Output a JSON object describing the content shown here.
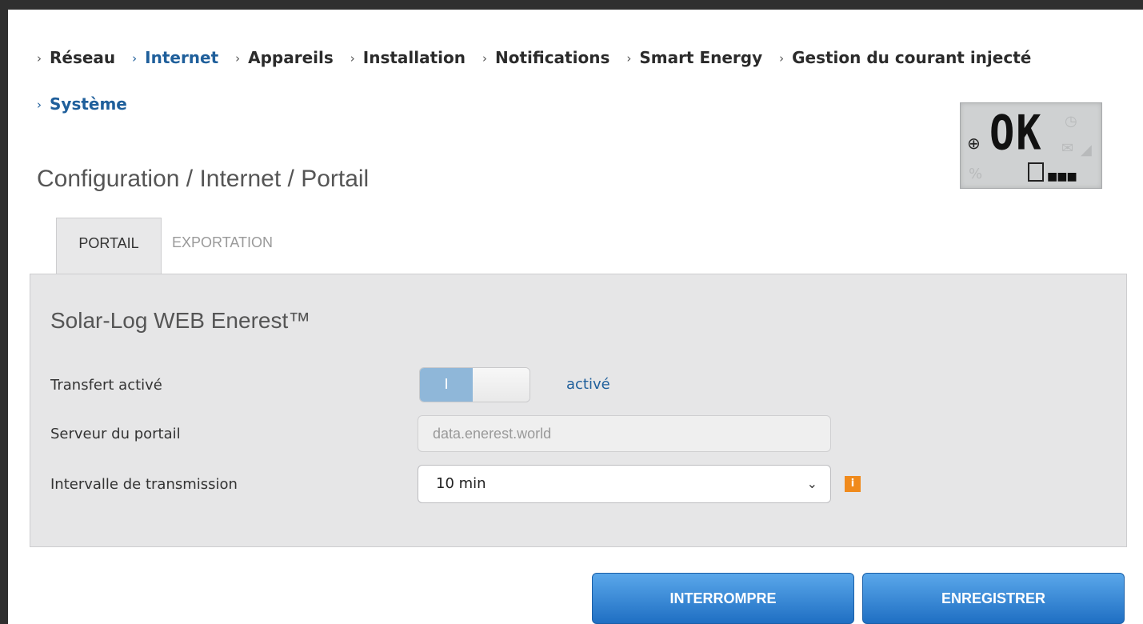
{
  "nav": {
    "items": [
      {
        "label": "Réseau"
      },
      {
        "label": "Internet"
      },
      {
        "label": "Appareils"
      },
      {
        "label": "Installation"
      },
      {
        "label": "Notifications"
      },
      {
        "label": "Smart Energy"
      },
      {
        "label": "Gestion du courant injecté"
      },
      {
        "label": "Système"
      }
    ],
    "chevron": "›"
  },
  "page": {
    "title": "Configuration / Internet / Portail"
  },
  "status_display": {
    "text": "OK",
    "icon": "globe-icon"
  },
  "tabs": [
    {
      "label": "PORTAIL"
    },
    {
      "label": "EXPORTATION"
    }
  ],
  "panel": {
    "title": "Solar-Log WEB Enerest™",
    "transfer": {
      "label": "Transfert activé",
      "toggle_text": "I",
      "state": "activé"
    },
    "server": {
      "label": "Serveur du portail",
      "value": "data.enerest.world"
    },
    "interval": {
      "label": "Intervalle de transmission",
      "value": "10 min"
    },
    "info_icon": "i"
  },
  "buttons": {
    "cancel": "INTERROMPRE",
    "save": "ENREGISTRER"
  },
  "colors": {
    "accent": "#1f5f9b",
    "button": "#2a7ed0",
    "warning": "#f08a1c"
  }
}
